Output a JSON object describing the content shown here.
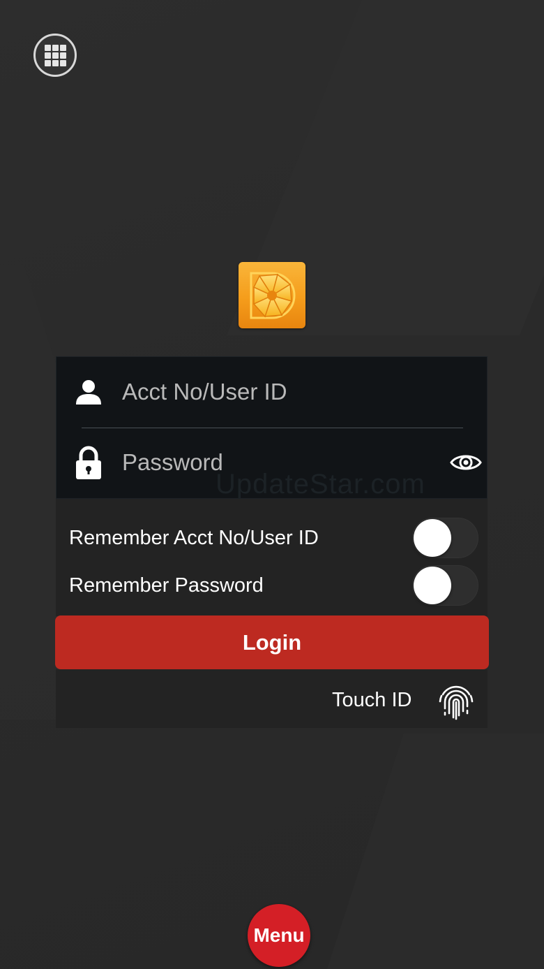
{
  "login_form": {
    "user_placeholder": "Acct No/User ID",
    "password_placeholder": "Password",
    "watermark": "UpdateStar.com"
  },
  "options": {
    "remember_user_label": "Remember Acct No/User ID",
    "remember_user_on": false,
    "remember_password_label": "Remember Password",
    "remember_password_on": false
  },
  "login_button_label": "Login",
  "touch_id_label": "Touch ID",
  "menu_button_label": "Menu",
  "icons": {
    "apps": "grid-icon",
    "user": "user-icon",
    "lock": "lock-icon",
    "eye": "eye-icon",
    "fingerprint": "fingerprint-icon",
    "logo": "aperture-logo"
  },
  "colors": {
    "background": "#2b2b2b",
    "card": "#111417",
    "panel": "#232323",
    "login_button": "#bd2a21",
    "menu_button": "#d41f26",
    "logo": "#f59d1b"
  }
}
